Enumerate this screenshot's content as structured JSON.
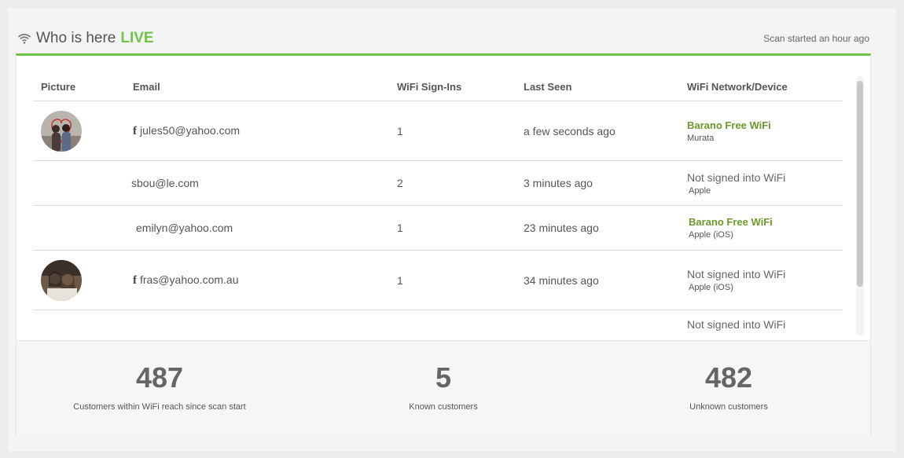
{
  "header": {
    "title": "Who is here",
    "live": "LIVE",
    "scan_status": "Scan started an hour ago"
  },
  "table": {
    "columns": [
      "Picture",
      "Email",
      "WiFi Sign-Ins",
      "Last Seen",
      "WiFi Network/Device"
    ],
    "rows": [
      {
        "has_picture": true,
        "facebook": true,
        "email": "jules50@yahoo.com",
        "signins": "1",
        "last_seen": "a few seconds ago",
        "network": "Barano Free WiFi",
        "network_signed_in": true,
        "device": "Murata"
      },
      {
        "has_picture": false,
        "facebook": false,
        "email": "sbou@le.com",
        "signins": "2",
        "last_seen": "3 minutes ago",
        "network": "Not signed into WiFi",
        "network_signed_in": false,
        "device": "Apple"
      },
      {
        "has_picture": false,
        "facebook": false,
        "email": "emilyn@yahoo.com",
        "signins": "1",
        "last_seen": "23 minutes ago",
        "network": "Barano Free WiFi",
        "network_signed_in": true,
        "device": "Apple (iOS)"
      },
      {
        "has_picture": true,
        "facebook": true,
        "email": "fras@yahoo.com.au",
        "signins": "1",
        "last_seen": "34 minutes ago",
        "network": "Not signed into WiFi",
        "network_signed_in": false,
        "device": "Apple (iOS)"
      },
      {
        "has_picture": false,
        "facebook": false,
        "email": "",
        "signins": "",
        "last_seen": "",
        "network": "Not signed into WiFi",
        "network_signed_in": false,
        "device": ""
      }
    ]
  },
  "stats": [
    {
      "value": "487",
      "label": "Customers within WiFi reach since scan start"
    },
    {
      "value": "5",
      "label": "Known customers"
    },
    {
      "value": "482",
      "label": "Unknown customers"
    }
  ],
  "colors": {
    "accent": "#6cc644",
    "network_green": "#6b9a2a"
  },
  "icons": {
    "header": "wifi-icon",
    "email_prefix": "facebook-icon"
  }
}
